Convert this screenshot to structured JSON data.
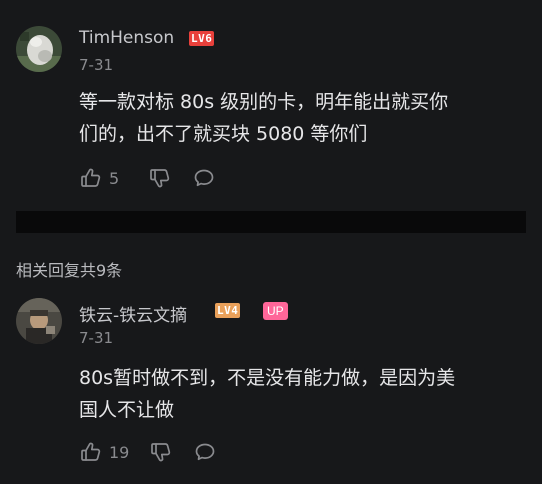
{
  "comment_1": {
    "username": "TimHenson",
    "level": "LV6",
    "date": "7-31",
    "text_line1": "等一款对标 80s 级别的卡，明年能出就买你",
    "text_line2": "们的，出不了就买块 5080 等你们",
    "like_count": "5"
  },
  "replies_header": "相关回复共9条",
  "comment_2": {
    "username": "铁云-铁云文摘",
    "level": "LV4",
    "up_badge": "UP",
    "date": "7-31",
    "text_line1": "80s暂时做不到，不是没有能力做，是因为美",
    "text_line2": "国人不让做",
    "like_count": "19"
  },
  "colors": {
    "background": "#17181a",
    "level6": "#e8403b",
    "level4": "#e9a05a",
    "up_badge": "#ff6699"
  }
}
